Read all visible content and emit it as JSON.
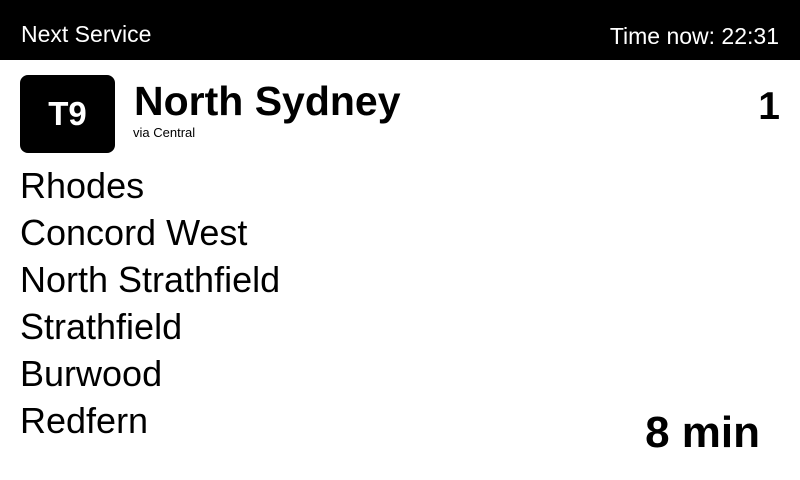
{
  "header": {
    "title": "Next Service",
    "time_text": "Time now: 22:31"
  },
  "service": {
    "line": "T9",
    "destination": "North Sydney",
    "via": "via Central",
    "platform": "1",
    "departs": "8 min"
  },
  "stops": [
    "Rhodes",
    "Concord West",
    "North Strathfield",
    "Strathfield",
    "Burwood",
    "Redfern"
  ],
  "colors": {
    "background": "#ffffff",
    "header_background": "#000000",
    "text": "#000000",
    "header_text": "#ffffff"
  }
}
